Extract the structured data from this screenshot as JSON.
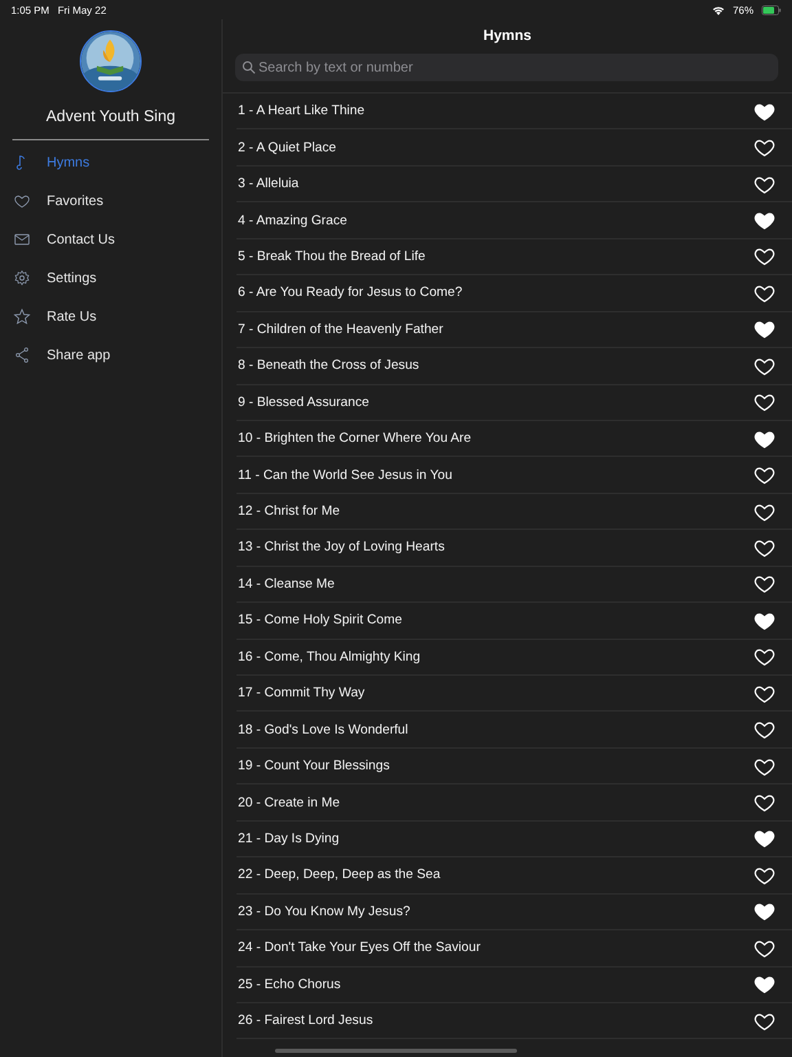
{
  "status_bar": {
    "time": "1:05 PM",
    "date": "Fri May 22",
    "battery": "76%"
  },
  "sidebar": {
    "app_name": "Advent Youth Sing",
    "items": [
      {
        "label": "Hymns",
        "selected": true
      },
      {
        "label": "Favorites",
        "selected": false
      },
      {
        "label": "Contact Us",
        "selected": false
      },
      {
        "label": "Settings",
        "selected": false
      },
      {
        "label": "Rate Us",
        "selected": false
      },
      {
        "label": "Share app",
        "selected": false
      }
    ]
  },
  "main": {
    "title": "Hymns",
    "search": {
      "placeholder": "Search by text or number"
    },
    "hymns": [
      {
        "title": "1 - A Heart Like Thine",
        "favorite": true
      },
      {
        "title": "2 - A Quiet Place",
        "favorite": false
      },
      {
        "title": "3 - Alleluia",
        "favorite": false
      },
      {
        "title": "4 - Amazing Grace",
        "favorite": true
      },
      {
        "title": "5 - Break Thou the Bread of Life",
        "favorite": false
      },
      {
        "title": "6 - Are You Ready for Jesus to Come?",
        "favorite": false
      },
      {
        "title": "7 - Children of the Heavenly Father",
        "favorite": true
      },
      {
        "title": "8 - Beneath the Cross of Jesus",
        "favorite": false
      },
      {
        "title": "9 - Blessed Assurance",
        "favorite": false
      },
      {
        "title": "10 - Brighten the Corner Where You Are",
        "favorite": true
      },
      {
        "title": "11 - Can the World See Jesus in You",
        "favorite": false
      },
      {
        "title": "12 - Christ for Me",
        "favorite": false
      },
      {
        "title": "13 - Christ the Joy of Loving Hearts",
        "favorite": false
      },
      {
        "title": "14 - Cleanse Me",
        "favorite": false
      },
      {
        "title": "15 - Come Holy Spirit Come",
        "favorite": true
      },
      {
        "title": "16 - Come, Thou Almighty King",
        "favorite": false
      },
      {
        "title": "17 - Commit Thy Way",
        "favorite": false
      },
      {
        "title": "18 - God's Love Is Wonderful",
        "favorite": false
      },
      {
        "title": "19 - Count Your Blessings",
        "favorite": false
      },
      {
        "title": "20 - Create in Me",
        "favorite": false
      },
      {
        "title": "21 - Day Is Dying",
        "favorite": true
      },
      {
        "title": "22 - Deep, Deep, Deep as the Sea",
        "favorite": false
      },
      {
        "title": "23 - Do You Know My Jesus?",
        "favorite": true
      },
      {
        "title": "24 - Don't Take Your Eyes Off the Saviour",
        "favorite": false
      },
      {
        "title": "25 - Echo Chorus",
        "favorite": true
      },
      {
        "title": "26 - Fairest Lord Jesus",
        "favorite": false
      }
    ]
  }
}
